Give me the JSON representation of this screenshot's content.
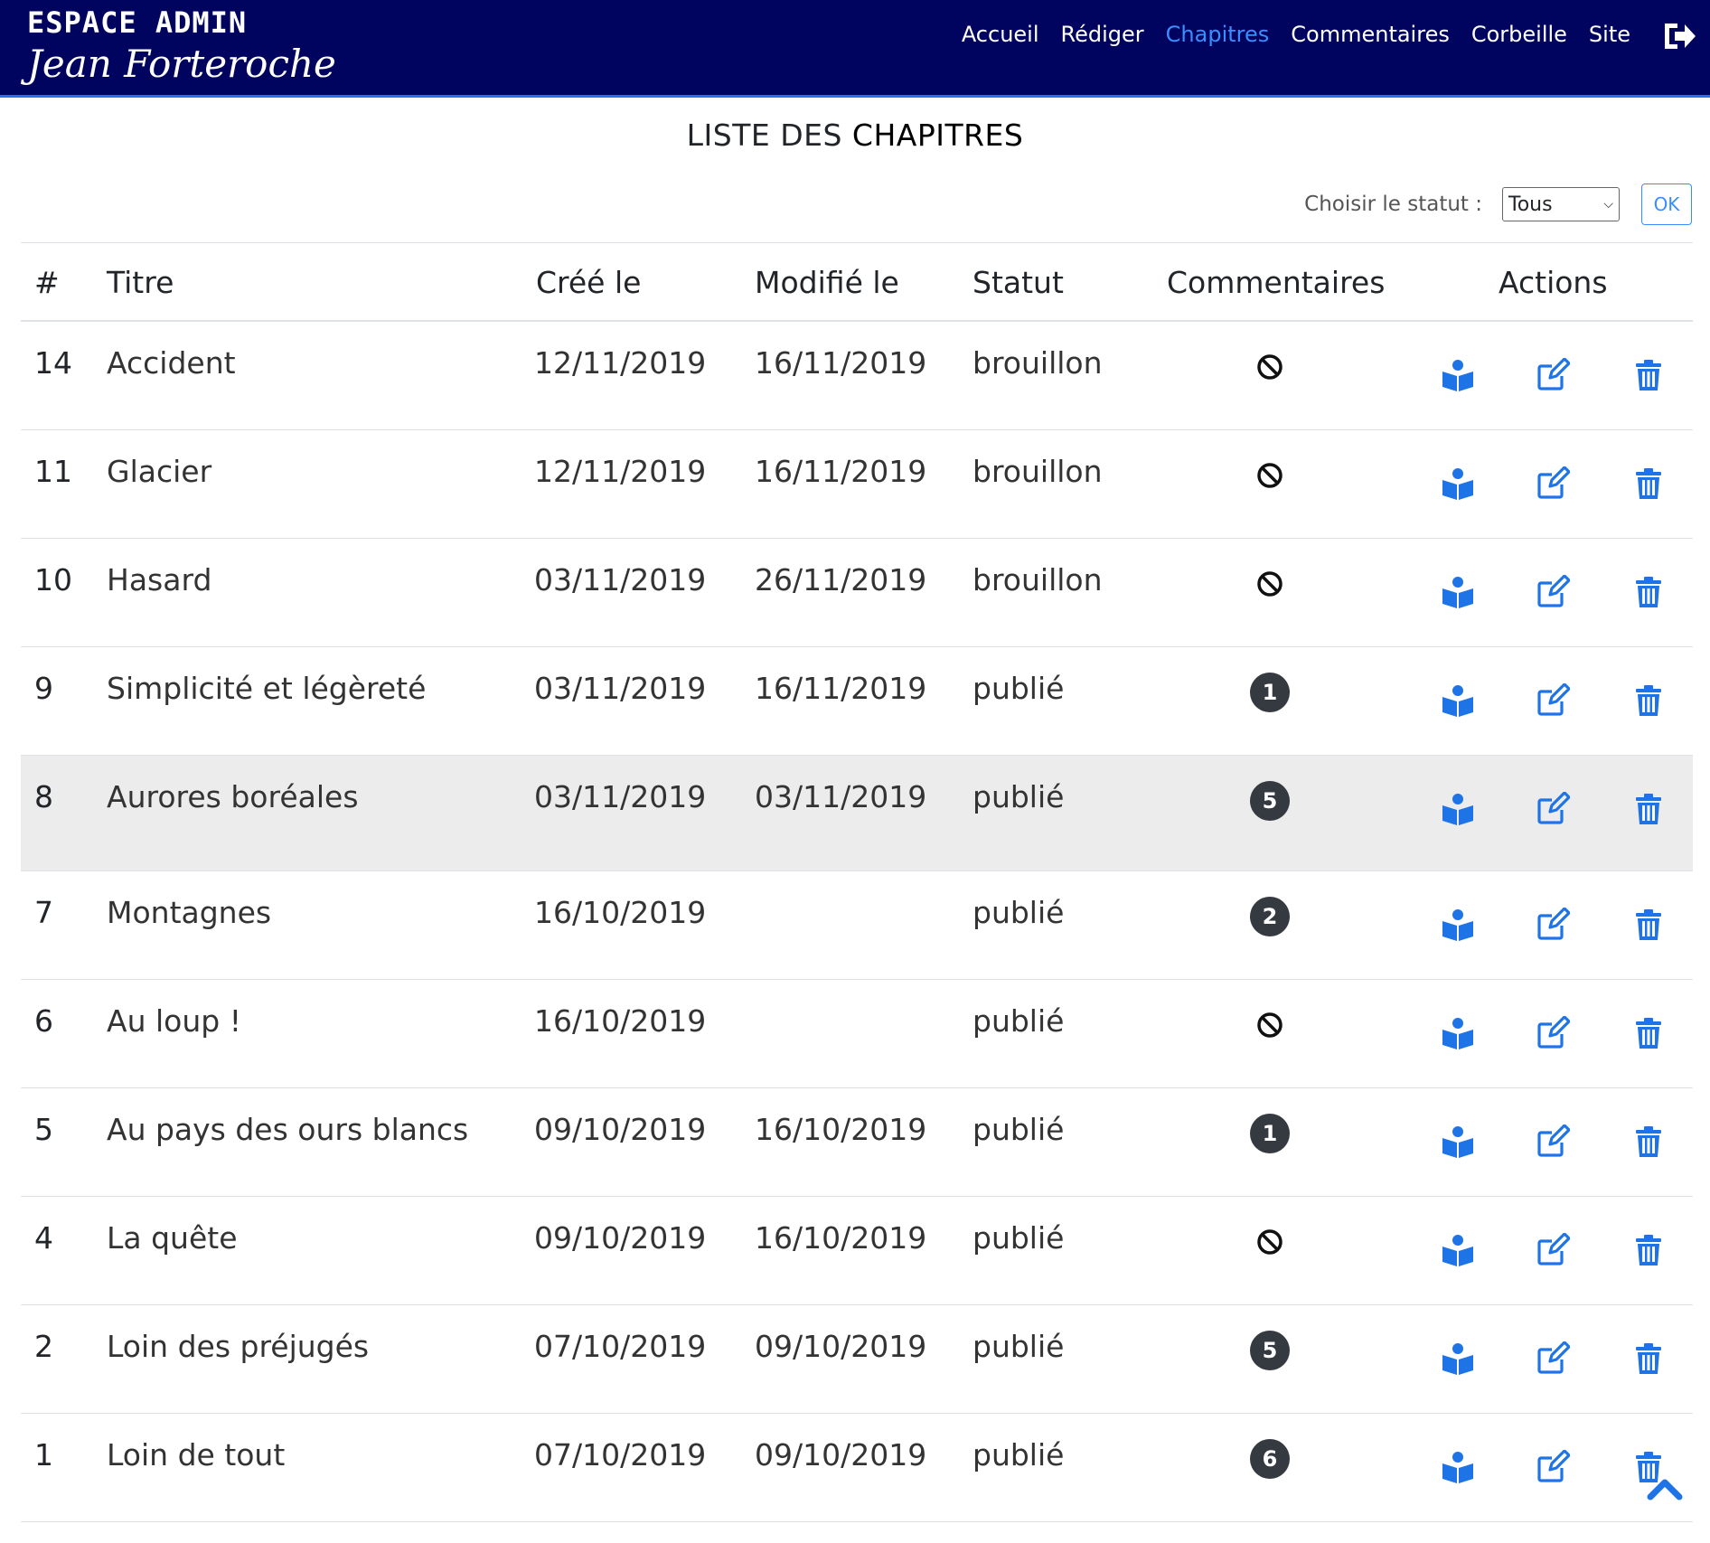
{
  "header": {
    "brand_line1": "ESPACE ADMIN",
    "brand_line2": "Jean Forteroche",
    "nav": [
      {
        "label": "Accueil",
        "active": false
      },
      {
        "label": "Rédiger",
        "active": false
      },
      {
        "label": "Chapitres",
        "active": true
      },
      {
        "label": "Commentaires",
        "active": false
      },
      {
        "label": "Corbeille",
        "active": false
      },
      {
        "label": "Site",
        "active": false
      }
    ],
    "logout_icon": "sign-out-icon"
  },
  "page": {
    "title_light": "LISTE DES",
    "title_strong": "CHAPITRES"
  },
  "filter": {
    "label": "Choisir le statut :",
    "selected": "Tous",
    "ok_label": "OK"
  },
  "table": {
    "headers": {
      "num": "#",
      "title": "Titre",
      "created": "Créé le",
      "modified": "Modifié le",
      "status": "Statut",
      "comments": "Commentaires",
      "actions": "Actions"
    },
    "rows": [
      {
        "num": "14",
        "title": "Accident",
        "created": "12/11/2019",
        "modified": "16/11/2019",
        "status": "brouillon",
        "comments": null
      },
      {
        "num": "11",
        "title": "Glacier",
        "created": "12/11/2019",
        "modified": "16/11/2019",
        "status": "brouillon",
        "comments": null
      },
      {
        "num": "10",
        "title": "Hasard",
        "created": "03/11/2019",
        "modified": "26/11/2019",
        "status": "brouillon",
        "comments": null
      },
      {
        "num": "9",
        "title": "Simplicité et légèreté",
        "created": "03/11/2019",
        "modified": "16/11/2019",
        "status": "publié",
        "comments": "1"
      },
      {
        "num": "8",
        "title": "Aurores boréales",
        "created": "03/11/2019",
        "modified": "03/11/2019",
        "status": "publié",
        "comments": "5",
        "highlighted": true
      },
      {
        "num": "7",
        "title": "Montagnes",
        "created": "16/10/2019",
        "modified": "",
        "status": "publié",
        "comments": "2"
      },
      {
        "num": "6",
        "title": "Au loup !",
        "created": "16/10/2019",
        "modified": "",
        "status": "publié",
        "comments": null
      },
      {
        "num": "5",
        "title": "Au pays des ours blancs",
        "created": "09/10/2019",
        "modified": "16/10/2019",
        "status": "publié",
        "comments": "1"
      },
      {
        "num": "4",
        "title": "La quête",
        "created": "09/10/2019",
        "modified": "16/10/2019",
        "status": "publié",
        "comments": null
      },
      {
        "num": "2",
        "title": "Loin des préjugés",
        "created": "07/10/2019",
        "modified": "09/10/2019",
        "status": "publié",
        "comments": "5"
      },
      {
        "num": "1",
        "title": "Loin de tout",
        "created": "07/10/2019",
        "modified": "09/10/2019",
        "status": "publié",
        "comments": "6"
      }
    ]
  },
  "colors": {
    "header_bg": "#01045f",
    "accent": "#1e74e6",
    "badge_bg": "#343a40",
    "row_highlight": "#ececec"
  }
}
